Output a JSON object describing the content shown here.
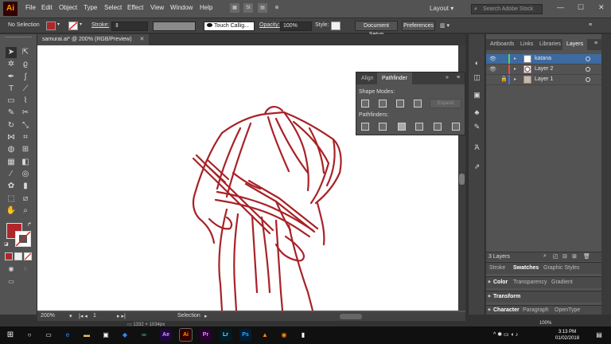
{
  "app": {
    "logo": "Ai"
  },
  "menu": [
    "File",
    "Edit",
    "Object",
    "Type",
    "Select",
    "Effect",
    "View",
    "Window",
    "Help"
  ],
  "menubar_right": {
    "workspace": "Layout",
    "search_placeholder": "Search Adobe Stock"
  },
  "controlbar": {
    "selection": "No Selection",
    "stroke_label": "Stroke:",
    "brush": "Touch Callig...",
    "opacity_label": "Opacity:",
    "opacity_value": "100%",
    "style_label": "Style:",
    "document_setup": "Document Setup",
    "preferences": "Preferences",
    "fill_color": "#b0262a"
  },
  "document": {
    "tab_title": "samurai.ai* @ 200% (RGB/Preview)"
  },
  "pathfinder": {
    "tabs": [
      "Align",
      "Pathfinder"
    ],
    "active_tab": "Pathfinder",
    "shape_modes_label": "Shape Modes:",
    "pathfinders_label": "Pathfinders:",
    "expand_label": "Expand"
  },
  "right_panel": {
    "tabs": [
      "Artboards",
      "Links",
      "Libraries",
      "Layers"
    ],
    "active_tab": "Layers",
    "layers": [
      {
        "name": "katana",
        "color": "#4fd65a",
        "selected": true,
        "visible": true
      },
      {
        "name": "Layer 2",
        "color": "#e84848",
        "selected": false,
        "visible": true
      },
      {
        "name": "Layer 1",
        "color": "#4a6fe8",
        "selected": false,
        "visible": false,
        "locked": true
      }
    ],
    "layers_count": "3 Layers",
    "section_stroke": {
      "tabs": [
        "Stroke",
        "Swatches",
        "Graphic Styles"
      ],
      "active": "Swatches"
    },
    "section_color": {
      "tabs": [
        "Color",
        "Transparency",
        "Gradient"
      ],
      "active": "Color"
    },
    "section_transform": {
      "tabs": [
        "Transform"
      ],
      "active": "Transform"
    },
    "section_character": {
      "tabs": [
        "Character",
        "Paragraph",
        "OpenType"
      ],
      "active": "Character"
    }
  },
  "statusbar": {
    "zoom": "200%",
    "artboard": "1",
    "tool": "Selection"
  },
  "bottom": {
    "coords": "1332 × 1034px",
    "zoom_pct": "100%"
  },
  "taskbar": {
    "time": "3:13 PM",
    "date": "01/02/2018",
    "apps": [
      "Ae",
      "Ai",
      "Pr",
      "Lr",
      "Ps"
    ]
  },
  "art": {
    "stroke_color": "#a82227"
  }
}
